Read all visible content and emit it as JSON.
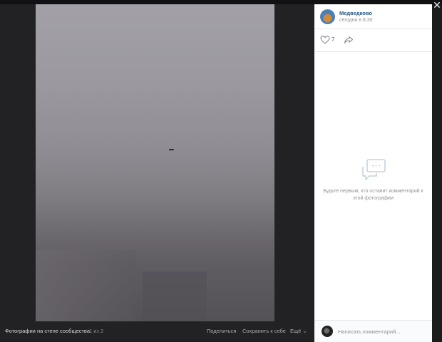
{
  "viewer": {
    "close_label": "✕",
    "album_label": "Фотографии на стене сообщества",
    "counter": "1 из 2",
    "share_label": "Поделиться",
    "save_label": "Сохранить к себе",
    "more_label": "Ещё ⌄"
  },
  "post": {
    "author": "Медведково",
    "date": "сегодня в 8:30",
    "like_count": "7"
  },
  "comments": {
    "empty_text": "Будьте первым, кто оставит комментарий к этой фотографии",
    "input_placeholder": "Написать комментарий..."
  },
  "icons": {
    "like": "heart-icon",
    "share": "share-arrow-icon",
    "empty_comments": "comment-bubble-icon",
    "close": "close-icon"
  },
  "colors": {
    "author_link": "#2a5885",
    "muted_text": "#939393",
    "viewer_bg": "#222224"
  }
}
